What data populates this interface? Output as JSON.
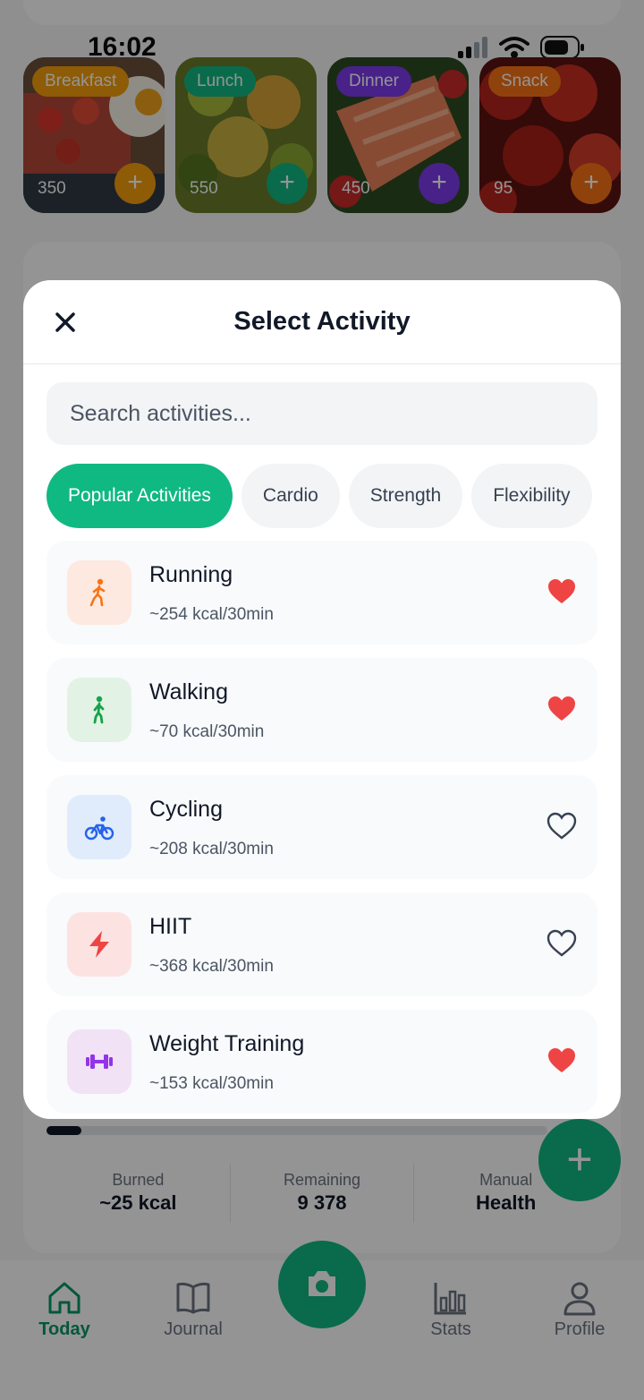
{
  "status_bar": {
    "time": "16:02"
  },
  "meals": [
    {
      "label": "Breakfast",
      "calories": "350",
      "pill_color": "#f59e0b",
      "add_color": "#f59e0b"
    },
    {
      "label": "Lunch",
      "calories": "550",
      "pill_color": "#10b981",
      "add_color": "#10b981"
    },
    {
      "label": "Dinner",
      "calories": "450",
      "pill_color": "#7c3aed",
      "add_color": "#7c3aed"
    },
    {
      "label": "Snack",
      "calories": "95",
      "pill_color": "#f97316",
      "add_color": "#f97316"
    }
  ],
  "summary": [
    {
      "label": "Burned",
      "value": "~25 kcal"
    },
    {
      "label": "Remaining",
      "value": "9 378"
    },
    {
      "label": "Manual",
      "value": "Health"
    }
  ],
  "progress": {
    "fraction": 0.07
  },
  "bottom_nav": [
    {
      "label": "Today",
      "icon": "home-icon"
    },
    {
      "label": "Journal",
      "icon": "book-icon"
    },
    {
      "label": "Stats",
      "icon": "bar-chart-icon"
    },
    {
      "label": "Profile",
      "icon": "user-icon"
    }
  ],
  "modal": {
    "title": "Select Activity",
    "search_placeholder": "Search activities...",
    "chips": [
      "Popular Activities",
      "Cardio",
      "Strength",
      "Flexibility"
    ],
    "active_chip": "Popular Activities",
    "activities": [
      {
        "name": "Running",
        "kcal": "~254 kcal/30min",
        "favorite": true,
        "icon": "running-icon",
        "color": "#f97316",
        "bg": "#fde9df"
      },
      {
        "name": "Walking",
        "kcal": "~70 kcal/30min",
        "favorite": true,
        "icon": "walking-icon",
        "color": "#16a34a",
        "bg": "#e2f3e5"
      },
      {
        "name": "Cycling",
        "kcal": "~208 kcal/30min",
        "favorite": false,
        "icon": "cycling-icon",
        "color": "#2563eb",
        "bg": "#e0ecfb"
      },
      {
        "name": "HIIT",
        "kcal": "~368 kcal/30min",
        "favorite": false,
        "icon": "lightning-icon",
        "color": "#ef4444",
        "bg": "#fde2e2"
      },
      {
        "name": "Weight Training",
        "kcal": "~153 kcal/30min",
        "favorite": true,
        "icon": "dumbbell-icon",
        "color": "#9333ea",
        "bg": "#f1e2f6"
      }
    ]
  },
  "colors": {
    "accent": "#10b981",
    "favorite": "#ef4444"
  }
}
